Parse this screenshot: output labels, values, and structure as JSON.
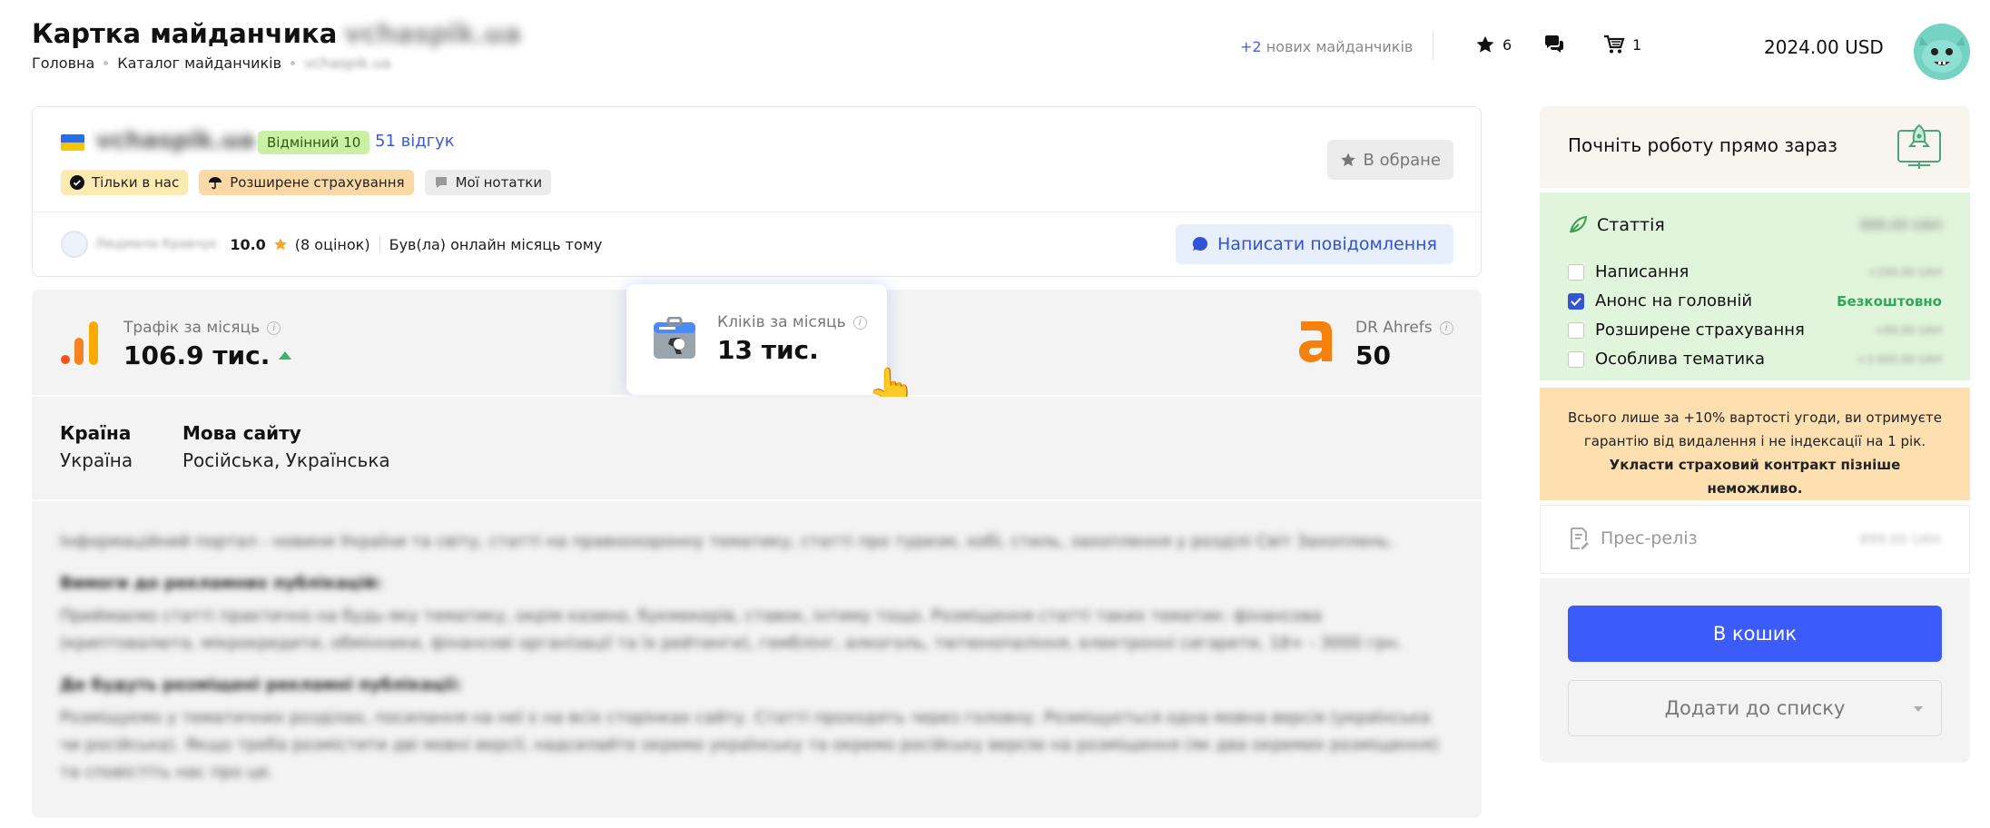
{
  "header": {
    "title": "Картка майданчика",
    "title_domain": "vchaspik.ua",
    "breadcrumb": [
      "Головна",
      "Каталог майданчиків",
      "vchaspik.ua"
    ],
    "new_sites_count": "+2",
    "new_sites_label": "нових майданчиків",
    "favorites_count": "6",
    "cart_count": "1",
    "balance": "2024.00 USD"
  },
  "site": {
    "name": "vchaspik.ua",
    "rating_badge": "Відмінний 10",
    "reviews_link": "51 відгук",
    "tags": [
      "Тільки в нас",
      "Розширене страхування",
      "Мої нотатки"
    ],
    "favorite_button": "В обране",
    "owner_name": "Людмила Кравчук",
    "owner_score": "10.0",
    "owner_ratings": "(8 оцінок)",
    "owner_status": "Був(ла) онлайн місяць тому",
    "message_button": "Написати повідомлення"
  },
  "stats": {
    "traffic_label": "Трафік за місяць",
    "traffic_value": "106.9 тис.",
    "clicks_label": "Кліків за місяць",
    "clicks_value": "13 тис.",
    "dr_label": "DR Ahrefs",
    "dr_value": "50"
  },
  "info": {
    "country_label": "Країна",
    "country_value": "Україна",
    "language_label": "Мова сайту",
    "language_value": "Російська, Українська"
  },
  "description": {
    "intro": "Інформаційний портал - новини України та світу, статті на правоохоронну тематику, статті про туризм, хобі, стиль, захоплення у розділі Світ Захоплень.",
    "req_heading": "Вимоги до рекламних публікацій:",
    "req_text": "Приймаємо статті практично на будь-яку тематику, окрім казино, букмекерів, ставок, інтиму тощо. Розміщення статті таких тематик: фінансова (криптовалюта, мікрокредити, обмінники, фінансові організації та їх рейтинги), гемблінг, алкоголь, тютюнопаління, електронні сигарети, 18+ - 3000 грн.",
    "place_heading": "Де будуть розміщені рекламні публікації:",
    "place_text": "Розміщуємо у тематичних розділах, посилання на неї є на всіх сторінках сайту. Статті проходять через головну. Розміщується одна мовна версія (українська чи російська). Якщо треба розмістити дві мовні версії, надсилайте окремо українську та окремо російську версію на розміщення (як два окремих розміщення) та сповістіть нас про це."
  },
  "panel": {
    "start_title": "Почніть роботу прямо зараз",
    "article_label": "Статтія",
    "article_price": "899.00 UAH",
    "options": [
      {
        "label": "Написання",
        "price": "+299.00 UAH",
        "checked": false
      },
      {
        "label": "Анонс на головній",
        "price": "Безкоштовно",
        "checked": true
      },
      {
        "label": "Розширене страхування",
        "price": "+89.00 UAH",
        "checked": false
      },
      {
        "label": "Особлива тематика",
        "price": "+3 000.00 UAH",
        "checked": false
      }
    ],
    "notice_text": "Всього лише за +10% вартості угоди, ви отримуєте гарантію від видалення і не індексації на 1 рік.",
    "notice_bold": "Укласти страховий контракт пізніше неможливо.",
    "press_label": "Прес-реліз",
    "press_price": "899.00 UAH",
    "cart_button": "В кошик",
    "list_button": "Додати до списку"
  },
  "colors": {
    "accent": "#3b5bfa",
    "link": "#3a5ad8",
    "green_panel": "#e1f4dc",
    "notice_bg": "#fddfb0",
    "free_text": "#2fa85a"
  }
}
